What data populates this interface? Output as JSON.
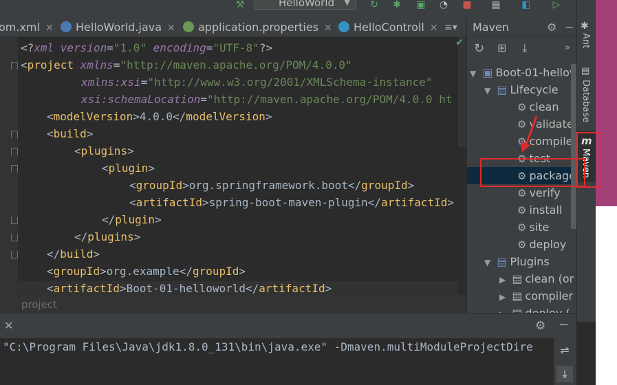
{
  "toolbar": {
    "run_config": "HelloWorld"
  },
  "tabs": [
    {
      "label": "om.xml"
    },
    {
      "label": "HelloWorld.java"
    },
    {
      "label": "application.properties"
    },
    {
      "label": "HelloControll"
    }
  ],
  "editor": {
    "lines": [
      {
        "p1": "<?",
        "p2": "xml ",
        "p3": "version",
        "p4": "=",
        "p5": "\"1.0\" ",
        "p6": "encoding",
        "p7": "=",
        "p8": "\"UTF-8\"",
        "p9": "?>"
      },
      {
        "p1": "<",
        "p2": "project ",
        "p3": "xmlns",
        "p4": "=",
        "p5": "\"http://maven.apache.org/POM/4.0.0\""
      },
      {
        "p1": "xmlns:xsi",
        "p2": "=",
        "p3": "\"http://www.w3.org/2001/XMLSchema-instance\""
      },
      {
        "p1": "xsi",
        "p2": ":schemaLocation",
        "p3": "=",
        "p4": "\"http://maven.apache.org/POM/4.0.0 ht"
      },
      {
        "open": "<",
        "name": "modelVersion",
        "close": ">",
        "text": "4.0.0",
        "end": "</",
        "end_name": "modelVersion",
        "end_close": ">"
      },
      {
        "open": "<",
        "name": "build",
        "close": ">"
      },
      {
        "open": "<",
        "name": "plugins",
        "close": ">"
      },
      {
        "open": "<",
        "name": "plugin",
        "close": ">"
      },
      {
        "open": "<",
        "name": "groupId",
        "close": ">",
        "text": "org.springframework.boot",
        "end": "</",
        "end_name": "groupId",
        "end_close": ">"
      },
      {
        "open": "<",
        "name": "artifactId",
        "close": ">",
        "text": "spring-boot-maven-plugin",
        "end": "</",
        "end_name": "artifactId",
        "end_close": ">"
      },
      {
        "open": "</",
        "name": "plugin",
        "close": ">"
      },
      {
        "open": "</",
        "name": "plugins",
        "close": ">"
      },
      {
        "open": "</",
        "name": "build",
        "close": ">"
      },
      {
        "open": "<",
        "name": "groupId",
        "close": ">",
        "text": "org.example",
        "end": "</",
        "end_name": "groupId",
        "end_close": ">"
      },
      {
        "open": "<",
        "name": "artifactId",
        "close": ">",
        "text": "Boot-01-helloworld",
        "end": "</",
        "end_name": "artifactId",
        "end_close": ">"
      }
    ],
    "breadcrumb": "project"
  },
  "maven": {
    "title": "Maven",
    "project": "Boot-01-hellow",
    "lifecycle_label": "Lifecycle",
    "lifecycle": [
      "clean",
      "validate",
      "compile",
      "test",
      "package",
      "verify",
      "install",
      "site",
      "deploy"
    ],
    "plugins_label": "Plugins",
    "plugins": [
      "clean (or",
      "compiler",
      "deploy ("
    ]
  },
  "side_tabs": {
    "ant": "Ant",
    "database": "Database",
    "maven": "Maven"
  },
  "console": {
    "line": "\"C:\\Program Files\\Java\\jdk1.8.0_131\\bin\\java.exe\" -Dmaven.multiModuleProjectDire"
  },
  "colors": {
    "highlight_box": "#e32a2a",
    "selection": "#0d293e"
  }
}
